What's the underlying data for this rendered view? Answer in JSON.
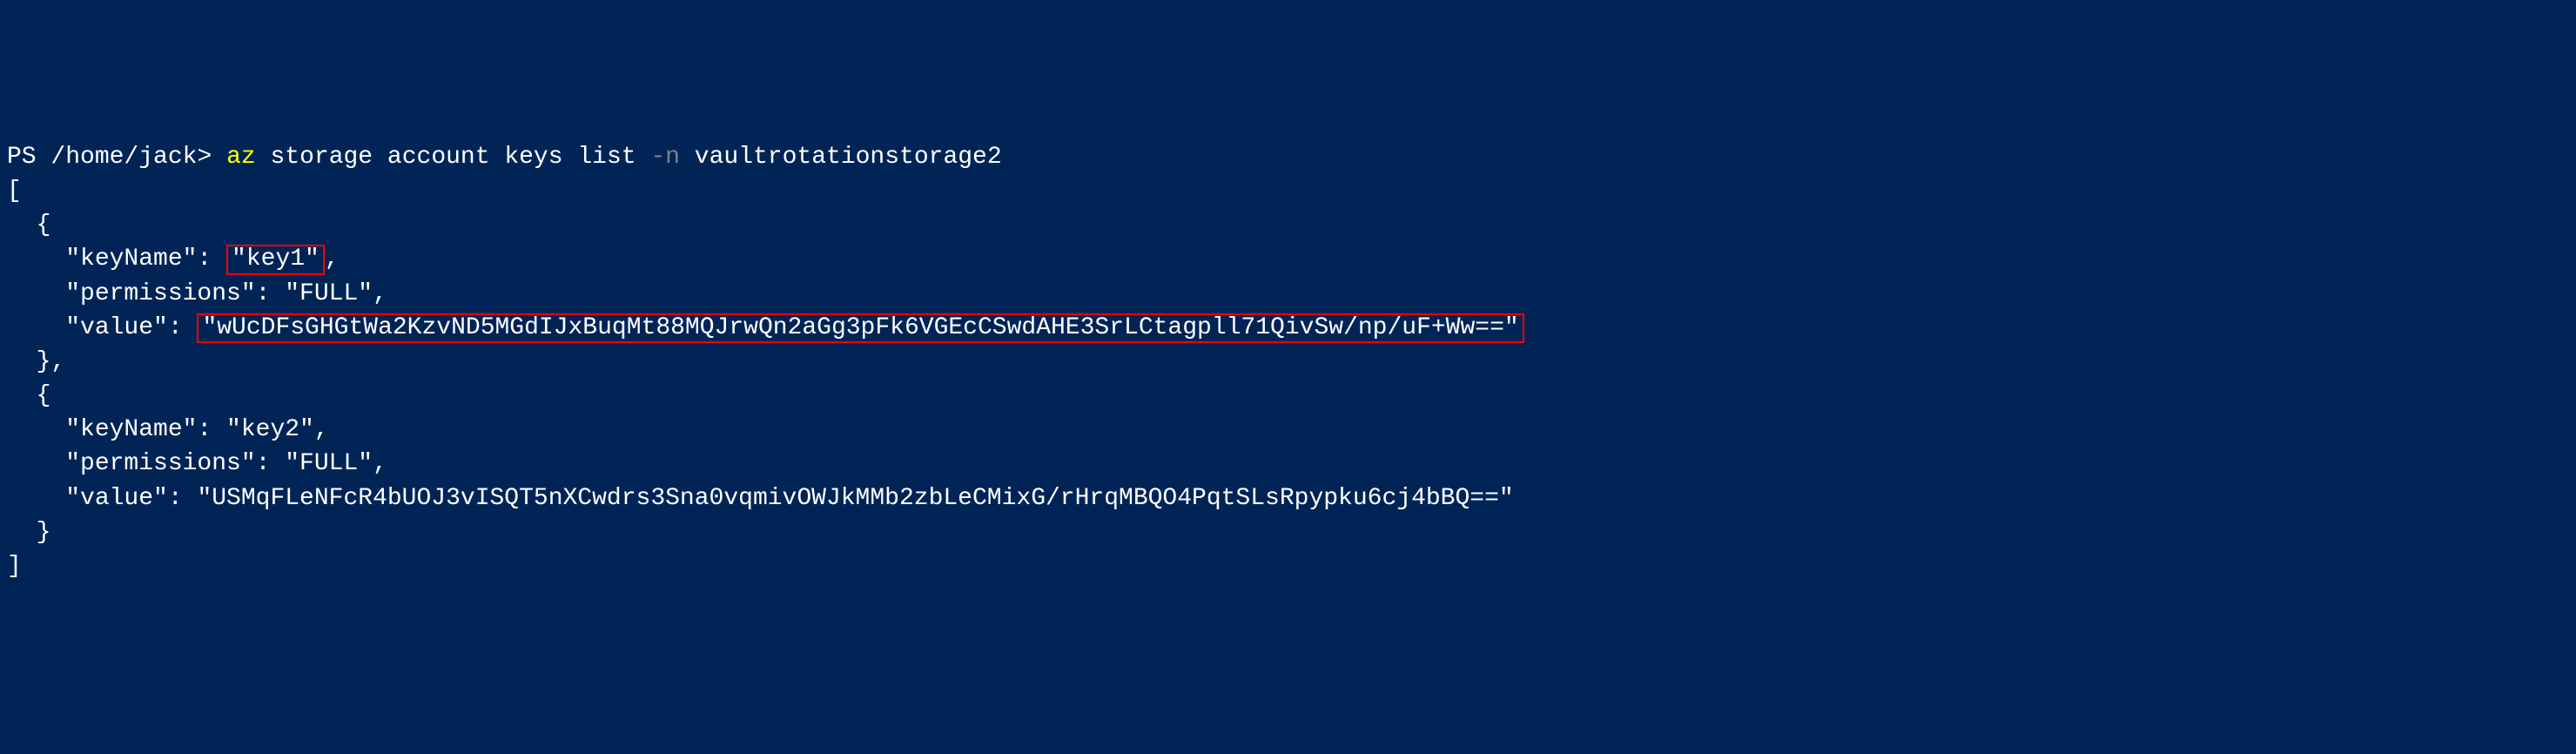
{
  "prompt": {
    "prefix": "PS ",
    "path": "/home/jack",
    "separator": "> "
  },
  "command": {
    "executable": "az",
    "subcommands": "storage account keys list",
    "param_flag": "-n",
    "param_value": "vaultrotationstorage2"
  },
  "output": {
    "bracket_open": "[",
    "bracket_close": "]",
    "entries": [
      {
        "brace_open": "  {",
        "keyName_label": "    \"keyName\": ",
        "keyName_value": "\"key1\"",
        "keyName_comma": ",",
        "permissions_line": "    \"permissions\": \"FULL\",",
        "value_label": "    \"value\": ",
        "value_value": "\"wUcDFsGHGtWa2KzvND5MGdIJxBuqMt88MQJrwQn2aGg3pFk6VGEcCSwdAHE3SrLCtagpll71QivSw/np/uF+Ww==\"",
        "brace_close": "  },",
        "highlight_keyName": true,
        "highlight_value": true
      },
      {
        "brace_open": "  {",
        "keyName_label": "    \"keyName\": ",
        "keyName_value": "\"key2\"",
        "keyName_comma": ",",
        "permissions_line": "    \"permissions\": \"FULL\",",
        "value_label": "    \"value\": ",
        "value_value": "\"USMqFLeNFcR4bUOJ3vISQT5nXCwdrs3Sna0vqmivOWJkMMb2zbLeCMixG/rHrqMBQO4PqtSLsRpypku6cj4bBQ==\"",
        "brace_close": "  }",
        "highlight_keyName": false,
        "highlight_value": false
      }
    ]
  }
}
